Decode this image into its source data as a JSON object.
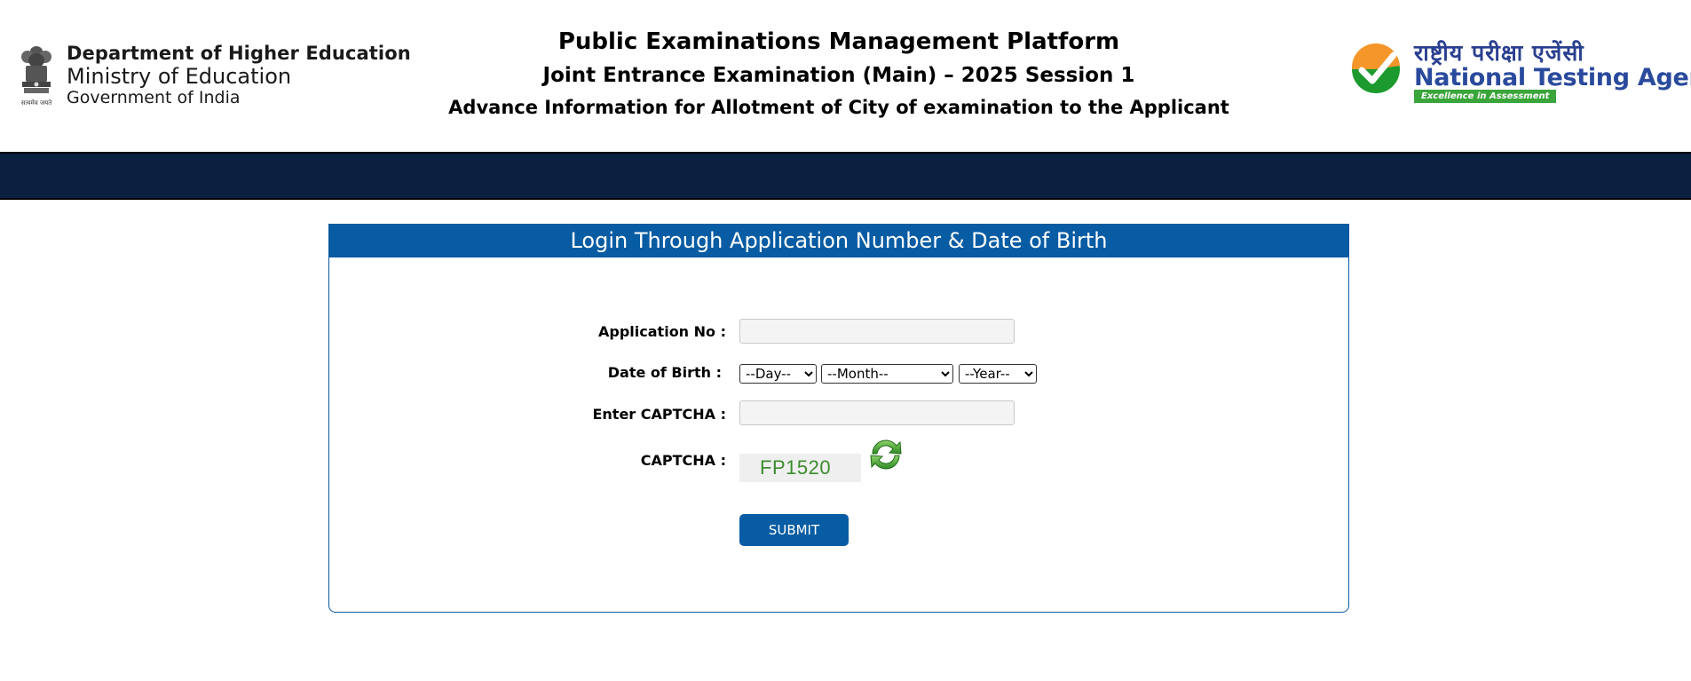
{
  "header": {
    "department": "Department of Higher Education",
    "ministry": "Ministry of Education",
    "government": "Government of India",
    "title": "Public Examinations Management Platform",
    "subtitle": "Joint Entrance Examination (Main) – 2025 Session 1",
    "description": "Advance Information for Allotment of City of examination to the Applicant",
    "nta_hindi": "राष्ट्रीय परीक्षा एजेंसी",
    "nta_name": "National Testing Agency",
    "nta_tagline": "Excellence in Assessment"
  },
  "login": {
    "heading": "Login Through Application Number & Date of Birth",
    "application_label": "Application No :",
    "application_value": "",
    "dob_label": "Date of Birth :",
    "day_selected": "--Day--",
    "month_selected": "--Month--",
    "year_selected": "--Year--",
    "captcha_input_label": "Enter CAPTCHA :",
    "captcha_input_value": "",
    "captcha_label": "CAPTCHA :",
    "captcha_text": "FP1520",
    "submit_label": "SUBMIT"
  },
  "icons": {
    "emblem": "national-emblem-icon",
    "nta_logo": "nta-checkmark-logo",
    "refresh": "refresh-icon"
  },
  "colors": {
    "navbar": "#0b1f40",
    "panel_header": "#075ca3",
    "submit_button": "#075ca3",
    "captcha_text": "#3c8c2e",
    "nta_orange": "#f5962a",
    "nta_green": "#1c9a2e"
  }
}
